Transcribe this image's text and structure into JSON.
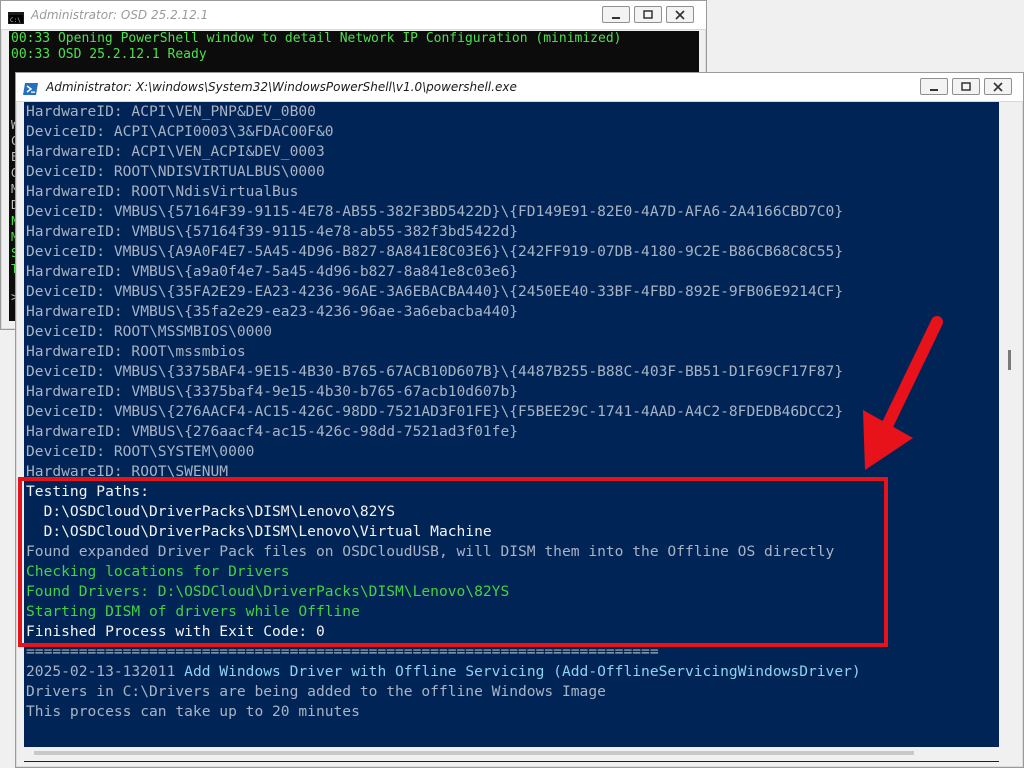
{
  "cmd_window": {
    "title": "Administrator:  OSD 25.2.12.1",
    "lines": [
      "00:33 Opening PowerShell window to detail Network IP Configuration (minimized)",
      "00:33 OSD 25.2.12.1 Ready"
    ],
    "left_strip": [
      "W",
      "C",
      "E",
      "G",
      "M",
      "D",
      "N",
      "M",
      "S",
      "T",
      ">"
    ],
    "controls": [
      "minimize",
      "maximize",
      "close"
    ]
  },
  "ps_window": {
    "title": "Administrator: X:\\windows\\System32\\WindowsPowerShell\\v1.0\\powershell.exe",
    "lines": [
      {
        "text": "HardwareID: ACPI\\VEN_PNP&DEV_0B00",
        "color": "gray"
      },
      {
        "text": "DeviceID: ACPI\\ACPI0003\\3&FDAC00F&0",
        "color": "gray"
      },
      {
        "text": "HardwareID: ACPI\\VEN_ACPI&DEV_0003",
        "color": "gray"
      },
      {
        "text": "DeviceID: ROOT\\NDISVIRTUALBUS\\0000",
        "color": "gray"
      },
      {
        "text": "HardwareID: ROOT\\NdisVirtualBus",
        "color": "gray"
      },
      {
        "text": "DeviceID: VMBUS\\{57164F39-9115-4E78-AB55-382F3BD5422D}\\{FD149E91-82E0-4A7D-AFA6-2A4166CBD7C0}",
        "color": "gray"
      },
      {
        "text": "HardwareID: VMBUS\\{57164f39-9115-4e78-ab55-382f3bd5422d}",
        "color": "gray"
      },
      {
        "text": "DeviceID: VMBUS\\{A9A0F4E7-5A45-4D96-B827-8A841E8C03E6}\\{242FF919-07DB-4180-9C2E-B86CB68C8C55}",
        "color": "gray"
      },
      {
        "text": "HardwareID: VMBUS\\{a9a0f4e7-5a45-4d96-b827-8a841e8c03e6}",
        "color": "gray"
      },
      {
        "text": "DeviceID: VMBUS\\{35FA2E29-EA23-4236-96AE-3A6EBACBA440}\\{2450EE40-33BF-4FBD-892E-9FB06E9214CF}",
        "color": "gray"
      },
      {
        "text": "HardwareID: VMBUS\\{35fa2e29-ea23-4236-96ae-3a6ebacba440}",
        "color": "gray"
      },
      {
        "text": "DeviceID: ROOT\\MSSMBIOS\\0000",
        "color": "gray"
      },
      {
        "text": "HardwareID: ROOT\\mssmbios",
        "color": "gray"
      },
      {
        "text": "DeviceID: VMBUS\\{3375BAF4-9E15-4B30-B765-67ACB10D607B}\\{4487B255-B88C-403F-BB51-D1F69CF17F87}",
        "color": "gray"
      },
      {
        "text": "HardwareID: VMBUS\\{3375baf4-9e15-4b30-b765-67acb10d607b}",
        "color": "gray"
      },
      {
        "text": "DeviceID: VMBUS\\{276AACF4-AC15-426C-98DD-7521AD3F01FE}\\{F5BEE29C-1741-4AAD-A4C2-8FDEDB46DCC2}",
        "color": "gray"
      },
      {
        "text": "HardwareID: VMBUS\\{276aacf4-ac15-426c-98dd-7521ad3f01fe}",
        "color": "gray"
      },
      {
        "text": "DeviceID: ROOT\\SYSTEM\\0000",
        "color": "gray"
      },
      {
        "text": "HardwareID: ROOT\\SWENUM",
        "color": "gray"
      },
      {
        "text": "Testing Paths:",
        "color": "white"
      },
      {
        "text": "  D:\\OSDCloud\\DriverPacks\\DISM\\Lenovo\\82YS",
        "color": "white"
      },
      {
        "text": "  D:\\OSDCloud\\DriverPacks\\DISM\\Lenovo\\Virtual Machine",
        "color": "white"
      },
      {
        "text": "Found expanded Driver Pack files on OSDCloudUSB, will DISM them into the Offline OS directly",
        "color": "gray"
      },
      {
        "text": "Checking locations for Drivers",
        "color": "green"
      },
      {
        "text": "Found Drivers: D:\\OSDCloud\\DriverPacks\\DISM\\Lenovo\\82YS",
        "color": "green"
      },
      {
        "text": "Starting DISM of drivers while Offline",
        "color": "green"
      },
      {
        "text": "Finished Process with Exit Code: 0",
        "color": "white"
      },
      {
        "text": "========================================================================",
        "color": "gray"
      },
      {
        "text": "2025-02-13-132011 ",
        "color": "gray",
        "suffix": "Add Windows Driver with Offline Servicing (Add-OfflineServicingWindowsDriver)",
        "suffix_color": "cyan"
      },
      {
        "text": "Drivers in C:\\Drivers are being added to the offline Windows Image",
        "color": "gray"
      },
      {
        "text": "This process can take up to 20 minutes",
        "color": "gray"
      }
    ],
    "controls": [
      "minimize",
      "maximize",
      "close"
    ]
  },
  "annotation": {
    "box_color": "#e8121b",
    "arrow_color": "#e8121b"
  }
}
